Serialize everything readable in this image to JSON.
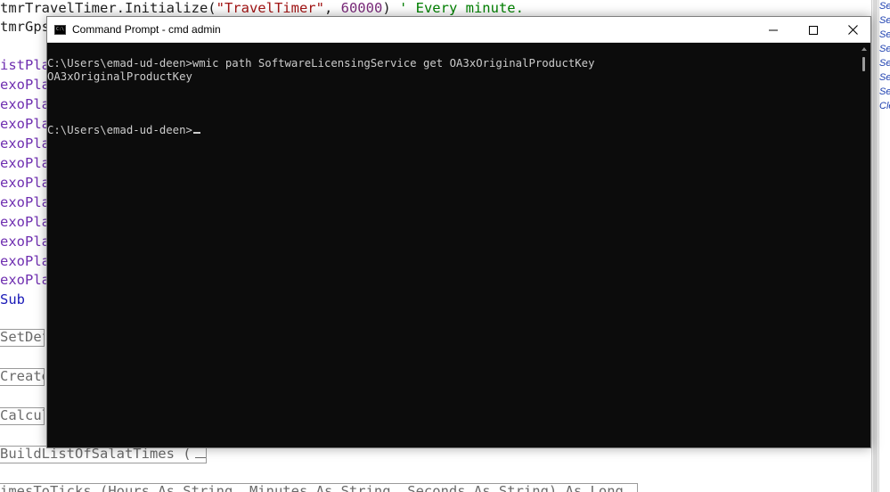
{
  "editor": {
    "line1": {
      "ident": "tmrTravelTimer",
      "method": ".Initialize(",
      "string": "\"TravelTimer\"",
      "comma": ", ",
      "number": "60000",
      "close": ") ",
      "comment": "' Every minute."
    },
    "line2": "tmrGps",
    "member_lines": [
      "istPla",
      "exoPla",
      "exoPla",
      "exoPla",
      "exoPla",
      "exoPla",
      "exoPla",
      "exoPla",
      "exoPla",
      "exoPla",
      "exoPla",
      "exoPla"
    ],
    "end_sub": "Sub",
    "method_boxes": [
      "SetDef",
      "Create",
      "Calcul",
      "BuildListOfSalatTimes ("
    ],
    "bottom_partial": "imesToTicks (Hours As String, Minutes As String, Seconds As String) As Long"
  },
  "side_panel": {
    "items": [
      "Se",
      "Se",
      "Se",
      "Se",
      "Se",
      "Se",
      "Se",
      "Cle"
    ]
  },
  "cmd": {
    "title": "Command Prompt - cmd  admin",
    "icon": "cmd-icon",
    "controls": {
      "minimize": "minimize-icon",
      "maximize": "maximize-icon",
      "close": "close-icon"
    },
    "lines": [
      "C:\\Users\\emad-ud-deen>wmic path SoftwareLicensingService get OA3xOriginalProductKey",
      "OA3xOriginalProductKey",
      "C:\\Users\\emad-ud-deen>"
    ]
  },
  "colors": {
    "console_bg": "#0c0c0c",
    "console_text": "#cccccc",
    "string": "#a31515",
    "comment": "#008000",
    "member": "#6f2fb0",
    "keyword": "#1a1ab8"
  }
}
